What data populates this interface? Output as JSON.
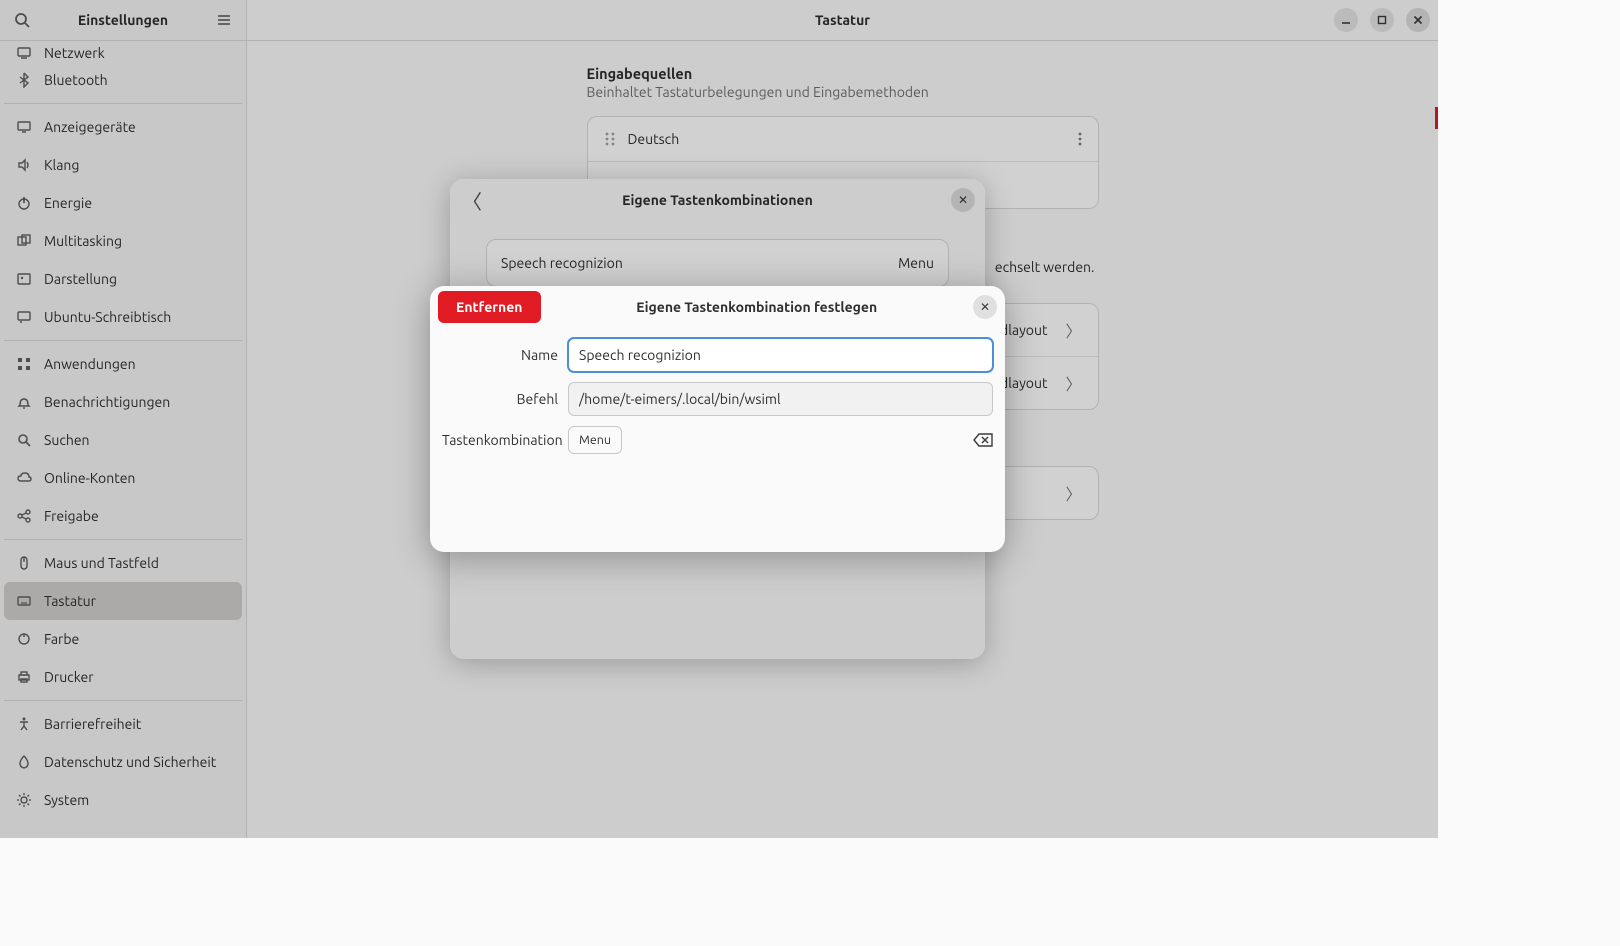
{
  "sidebar": {
    "title": "Einstellungen",
    "items": [
      {
        "label": "Netzwerk",
        "icon": "network",
        "cut": true
      },
      {
        "label": "Bluetooth",
        "icon": "bluetooth"
      },
      null,
      {
        "label": "Anzeigegeräte",
        "icon": "display"
      },
      {
        "label": "Klang",
        "icon": "sound"
      },
      {
        "label": "Energie",
        "icon": "power"
      },
      {
        "label": "Multitasking",
        "icon": "multitask"
      },
      {
        "label": "Darstellung",
        "icon": "appearance"
      },
      {
        "label": "Ubuntu-Schreibtisch",
        "icon": "ubuntu"
      },
      null,
      {
        "label": "Anwendungen",
        "icon": "apps"
      },
      {
        "label": "Benachrichtigungen",
        "icon": "bell"
      },
      {
        "label": "Suchen",
        "icon": "search"
      },
      {
        "label": "Online-Konten",
        "icon": "cloud"
      },
      {
        "label": "Freigabe",
        "icon": "share"
      },
      null,
      {
        "label": "Maus und Tastfeld",
        "icon": "mouse"
      },
      {
        "label": "Tastatur",
        "icon": "keyboard",
        "active": true
      },
      {
        "label": "Farbe",
        "icon": "color"
      },
      {
        "label": "Drucker",
        "icon": "printer"
      },
      null,
      {
        "label": "Barrierefreiheit",
        "icon": "a11y"
      },
      {
        "label": "Datenschutz und Sicherheit",
        "icon": "privacy"
      },
      {
        "label": "System",
        "icon": "system"
      }
    ]
  },
  "main": {
    "title": "Tastatur",
    "section_title": "Eingabequellen",
    "section_sub": "Beinhaltet Tastaturbelegungen und Eingabemethoden",
    "input_source": "Deutsch",
    "bg_hint_suffix": "echselt werden.",
    "layout_suffix": "ardlayout",
    "layout_suffix2": "ardlayout"
  },
  "modal1": {
    "title": "Eigene Tastenkombinationen",
    "rows": [
      {
        "name": "Speech recognizion",
        "accel": "Menu"
      }
    ]
  },
  "modal2": {
    "title": "Eigene Tastenkombination festlegen",
    "remove": "Entfernen",
    "name_label": "Name",
    "name_value": "Speech recognizion",
    "cmd_label": "Befehl",
    "cmd_value": "/home/t-eimers/.local/bin/wsiml",
    "accel_label": "Tastenkombination",
    "accel_value": "Menu"
  }
}
